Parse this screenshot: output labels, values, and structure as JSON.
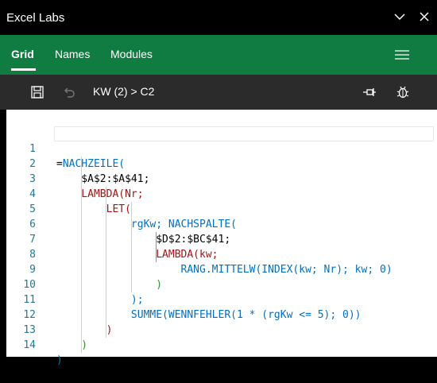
{
  "titlebar": {
    "title": "Excel Labs"
  },
  "nav": {
    "tabs": [
      "Grid",
      "Names",
      "Modules"
    ]
  },
  "toolbar": {
    "breadcrumb": "KW (2) > C2"
  },
  "editor": {
    "line_numbers": [
      "1",
      "2",
      "3",
      "4",
      "5",
      "6",
      "7",
      "8",
      "9",
      "10",
      "11",
      "12",
      "13",
      "14"
    ],
    "lines": [
      "=NACHZEILE(",
      "    $A$2:$A$41;",
      "    LAMBDA(Nr;",
      "        LET(",
      "            rgKw; NACHSPALTE(",
      "                $D$2:$BC$41;",
      "                LAMBDA(kw;",
      "                    RANG.MITTELW(INDEX(kw; Nr); kw; 0)",
      "                )",
      "            );",
      "            SUMME(WENNFEHLER(1 * (rgKw <= 5); 0))",
      "        )",
      "    )",
      ")"
    ]
  }
}
